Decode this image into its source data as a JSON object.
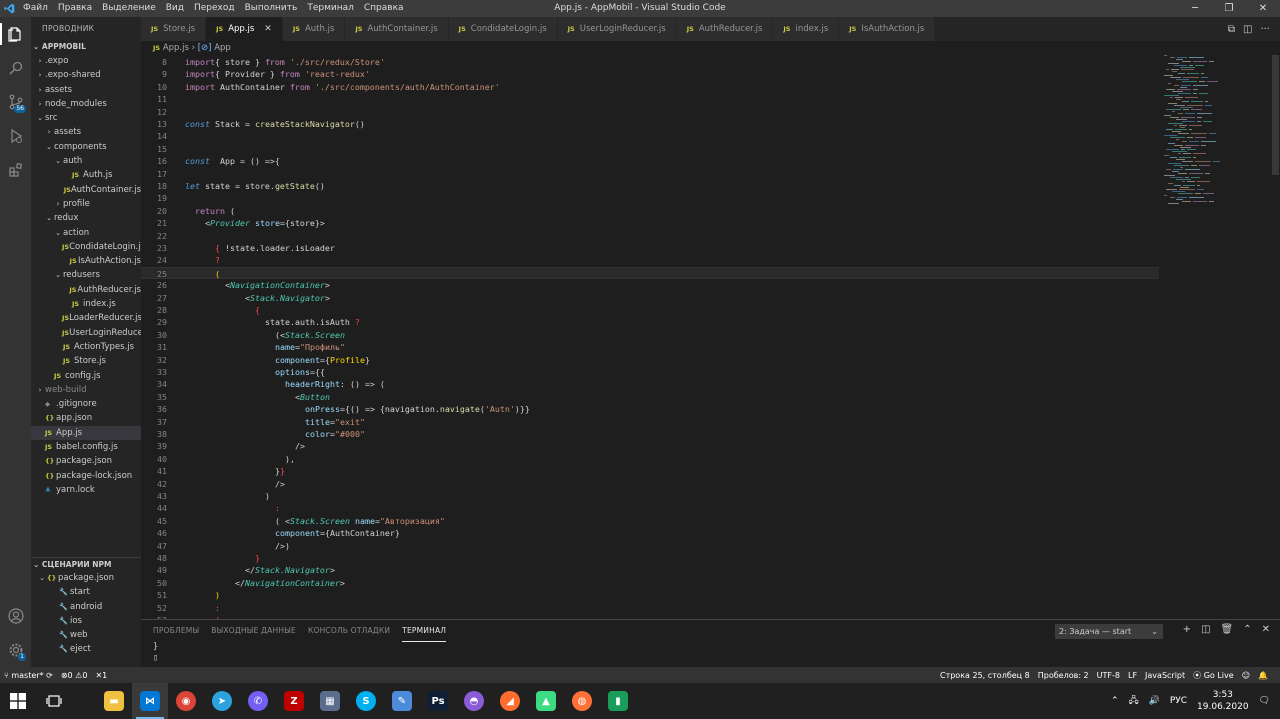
{
  "window": {
    "title": "App.js - AppMobil - Visual Studio Code",
    "menu": [
      "Файл",
      "Правка",
      "Выделение",
      "Вид",
      "Переход",
      "Выполнить",
      "Терминал",
      "Справка"
    ]
  },
  "sidebar": {
    "header": "ПРОВОДНИК",
    "project": "APPMOBIL",
    "items": [
      {
        "label": ".expo",
        "depth": 0,
        "kind": "folder",
        "open": false
      },
      {
        "label": ".expo-shared",
        "depth": 0,
        "kind": "folder",
        "open": false
      },
      {
        "label": "assets",
        "depth": 0,
        "kind": "folder",
        "open": false
      },
      {
        "label": "node_modules",
        "depth": 0,
        "kind": "folder",
        "open": false
      },
      {
        "label": "src",
        "depth": 0,
        "kind": "folder",
        "open": true
      },
      {
        "label": "assets",
        "depth": 1,
        "kind": "folder",
        "open": false
      },
      {
        "label": "components",
        "depth": 1,
        "kind": "folder",
        "open": true
      },
      {
        "label": "auth",
        "depth": 2,
        "kind": "folder",
        "open": true
      },
      {
        "label": "Auth.js",
        "depth": 3,
        "kind": "js"
      },
      {
        "label": "AuthContainer.js",
        "depth": 3,
        "kind": "js"
      },
      {
        "label": "profile",
        "depth": 2,
        "kind": "folder",
        "open": false
      },
      {
        "label": "redux",
        "depth": 1,
        "kind": "folder",
        "open": true
      },
      {
        "label": "action",
        "depth": 2,
        "kind": "folder",
        "open": true
      },
      {
        "label": "CondidateLogin.js",
        "depth": 3,
        "kind": "js"
      },
      {
        "label": "IsAuthAction.js",
        "depth": 3,
        "kind": "js"
      },
      {
        "label": "redusers",
        "depth": 2,
        "kind": "folder",
        "open": true
      },
      {
        "label": "AuthReducer.js",
        "depth": 3,
        "kind": "js"
      },
      {
        "label": "index.js",
        "depth": 3,
        "kind": "js"
      },
      {
        "label": "LoaderReducer.js",
        "depth": 3,
        "kind": "js"
      },
      {
        "label": "UserLoginReduce...",
        "depth": 3,
        "kind": "js"
      },
      {
        "label": "ActionTypes.js",
        "depth": 2,
        "kind": "js"
      },
      {
        "label": "Store.js",
        "depth": 2,
        "kind": "js"
      },
      {
        "label": "config.js",
        "depth": 1,
        "kind": "js"
      },
      {
        "label": "web-build",
        "depth": 0,
        "kind": "folder",
        "open": false,
        "dim": true
      },
      {
        "label": ".gitignore",
        "depth": 0,
        "kind": "dim"
      },
      {
        "label": "app.json",
        "depth": 0,
        "kind": "json"
      },
      {
        "label": "App.js",
        "depth": 0,
        "kind": "js",
        "selected": true
      },
      {
        "label": "babel.config.js",
        "depth": 0,
        "kind": "js"
      },
      {
        "label": "package.json",
        "depth": 0,
        "kind": "json"
      },
      {
        "label": "package-lock.json",
        "depth": 0,
        "kind": "json"
      },
      {
        "label": "yarn.lock",
        "depth": 0,
        "kind": "yarn"
      }
    ],
    "npm": {
      "header": "СЦЕНАРИИ NPM",
      "file": "package.json",
      "scripts": [
        "start",
        "android",
        "ios",
        "web",
        "eject"
      ]
    }
  },
  "tabs": [
    {
      "label": "Store.js",
      "active": false
    },
    {
      "label": "App.js",
      "active": true
    },
    {
      "label": "Auth.js",
      "active": false
    },
    {
      "label": "AuthContainer.js",
      "active": false
    },
    {
      "label": "CondidateLogin.js",
      "active": false
    },
    {
      "label": "UserLoginReducer.js",
      "active": false
    },
    {
      "label": "AuthReducer.js",
      "active": false
    },
    {
      "label": "index.js",
      "active": false
    },
    {
      "label": "IsAuthAction.js",
      "active": false
    }
  ],
  "breadcrumb": {
    "file": "App.js",
    "symbol": "App"
  },
  "editor": {
    "current_line": 25,
    "lines": [
      {
        "n": 8,
        "indent": 0,
        "tokens": [
          [
            "k",
            "import"
          ],
          [
            "",
            "{ store } "
          ],
          [
            "k",
            "from"
          ],
          [
            "s",
            " './src/redux/Store'"
          ]
        ]
      },
      {
        "n": 9,
        "indent": 0,
        "tokens": [
          [
            "k",
            "import"
          ],
          [
            "",
            "{ Provider } "
          ],
          [
            "k",
            "from"
          ],
          [
            "s",
            " 'react-redux'"
          ]
        ]
      },
      {
        "n": 10,
        "indent": 0,
        "tokens": [
          [
            "k",
            "import"
          ],
          [
            "",
            " AuthContainer "
          ],
          [
            "k",
            "from"
          ],
          [
            "s",
            " './src/components/auth/AuthContainer'"
          ]
        ]
      },
      {
        "n": 11,
        "indent": 0,
        "tokens": []
      },
      {
        "n": 12,
        "indent": 0,
        "tokens": []
      },
      {
        "n": 13,
        "indent": 0,
        "tokens": [
          [
            "kw",
            "const"
          ],
          [
            "",
            " Stack = "
          ],
          [
            "f",
            "createStackNavigator"
          ],
          [
            "",
            "()"
          ]
        ]
      },
      {
        "n": 14,
        "indent": 0,
        "tokens": []
      },
      {
        "n": 15,
        "indent": 0,
        "tokens": []
      },
      {
        "n": 16,
        "indent": 0,
        "tokens": [
          [
            "kw",
            "const"
          ],
          [
            "",
            "  App = () =>{"
          ]
        ]
      },
      {
        "n": 17,
        "indent": 0,
        "tokens": []
      },
      {
        "n": 18,
        "indent": 0,
        "tokens": [
          [
            "kw",
            "let"
          ],
          [
            "",
            " state = store."
          ],
          [
            "f",
            "getState"
          ],
          [
            "",
            "()"
          ]
        ]
      },
      {
        "n": 19,
        "indent": 0,
        "tokens": []
      },
      {
        "n": 20,
        "indent": 1,
        "tokens": [
          [
            "k",
            "return"
          ],
          [
            "",
            " ("
          ]
        ]
      },
      {
        "n": 21,
        "indent": 2,
        "tokens": [
          [
            "",
            "<"
          ],
          [
            "t",
            "Provider"
          ],
          [
            "",
            " "
          ],
          [
            "v",
            "store"
          ],
          [
            "",
            "={store}>"
          ]
        ]
      },
      {
        "n": 22,
        "indent": 0,
        "tokens": []
      },
      {
        "n": 23,
        "indent": 3,
        "tokens": [
          [
            "r",
            "{"
          ],
          [
            "",
            " !state.loader.isLoader"
          ]
        ]
      },
      {
        "n": 24,
        "indent": 3,
        "tokens": [
          [
            "r",
            "?"
          ]
        ]
      },
      {
        "n": 25,
        "indent": 3,
        "tokens": [
          [
            "y",
            "("
          ]
        ]
      },
      {
        "n": 26,
        "indent": 4,
        "tokens": [
          [
            "",
            "<"
          ],
          [
            "t",
            "NavigationContainer"
          ],
          [
            "",
            ">"
          ]
        ]
      },
      {
        "n": 27,
        "indent": 6,
        "tokens": [
          [
            "",
            "<"
          ],
          [
            "t",
            "Stack.Navigator"
          ],
          [
            "",
            ">"
          ]
        ]
      },
      {
        "n": 28,
        "indent": 7,
        "tokens": [
          [
            "r",
            "{"
          ]
        ]
      },
      {
        "n": 29,
        "indent": 8,
        "tokens": [
          [
            "",
            "state.auth.isAuth "
          ],
          [
            "r",
            "?"
          ]
        ]
      },
      {
        "n": 30,
        "indent": 9,
        "tokens": [
          [
            "",
            "(<"
          ],
          [
            "t",
            "Stack.Screen"
          ]
        ]
      },
      {
        "n": 31,
        "indent": 9,
        "tokens": [
          [
            "v",
            "name"
          ],
          [
            "",
            "="
          ],
          [
            "s",
            "\"Профиль\""
          ]
        ]
      },
      {
        "n": 32,
        "indent": 9,
        "tokens": [
          [
            "v",
            "component"
          ],
          [
            "",
            "={"
          ],
          [
            "y",
            "Profile"
          ],
          [
            "",
            "}"
          ]
        ]
      },
      {
        "n": 33,
        "indent": 9,
        "tokens": [
          [
            "v",
            "options"
          ],
          [
            "",
            "={{"
          ]
        ]
      },
      {
        "n": 34,
        "indent": 10,
        "tokens": [
          [
            "v",
            "headerRight"
          ],
          [
            "",
            ": () => ("
          ]
        ]
      },
      {
        "n": 35,
        "indent": 11,
        "tokens": [
          [
            "",
            "<"
          ],
          [
            "t",
            "Button"
          ]
        ]
      },
      {
        "n": 36,
        "indent": 12,
        "tokens": [
          [
            "v",
            "onPress"
          ],
          [
            "",
            "={() => {navigation."
          ],
          [
            "f",
            "navigate"
          ],
          [
            "",
            "("
          ],
          [
            "s",
            "'Autn'"
          ],
          [
            "",
            ")}}"
          ]
        ]
      },
      {
        "n": 37,
        "indent": 12,
        "tokens": [
          [
            "v",
            "title"
          ],
          [
            "",
            "="
          ],
          [
            "s",
            "\"exit\""
          ]
        ]
      },
      {
        "n": 38,
        "indent": 12,
        "tokens": [
          [
            "v",
            "color"
          ],
          [
            "",
            "="
          ],
          [
            "s",
            "\"#000\""
          ]
        ]
      },
      {
        "n": 39,
        "indent": 11,
        "tokens": [
          [
            "",
            "/>"
          ]
        ]
      },
      {
        "n": 40,
        "indent": 10,
        "tokens": [
          [
            "",
            "),"
          ]
        ]
      },
      {
        "n": 41,
        "indent": 9,
        "tokens": [
          [
            "",
            "}"
          ],
          [
            "r",
            "}"
          ]
        ]
      },
      {
        "n": 42,
        "indent": 9,
        "tokens": [
          [
            "",
            "/>"
          ]
        ]
      },
      {
        "n": 43,
        "indent": 8,
        "tokens": [
          [
            "",
            ")"
          ]
        ]
      },
      {
        "n": 44,
        "indent": 9,
        "tokens": [
          [
            "r",
            ":"
          ]
        ]
      },
      {
        "n": 45,
        "indent": 9,
        "tokens": [
          [
            "",
            "( <"
          ],
          [
            "t",
            "Stack.Screen"
          ],
          [
            "",
            " "
          ],
          [
            "v",
            "name"
          ],
          [
            "",
            "="
          ],
          [
            "s",
            "\"Авторизация\""
          ]
        ]
      },
      {
        "n": 46,
        "indent": 9,
        "tokens": [
          [
            "v",
            "component"
          ],
          [
            "",
            "={AuthContainer}"
          ]
        ]
      },
      {
        "n": 47,
        "indent": 9,
        "tokens": [
          [
            "",
            "/>)"
          ]
        ]
      },
      {
        "n": 48,
        "indent": 7,
        "tokens": [
          [
            "r",
            "}"
          ]
        ]
      },
      {
        "n": 49,
        "indent": 6,
        "tokens": [
          [
            "",
            "</"
          ],
          [
            "t",
            "Stack.Navigator"
          ],
          [
            "",
            ">"
          ]
        ]
      },
      {
        "n": 50,
        "indent": 5,
        "tokens": [
          [
            "",
            "</"
          ],
          [
            "t",
            "NavigationContainer"
          ],
          [
            "",
            ">"
          ]
        ]
      },
      {
        "n": 51,
        "indent": 3,
        "tokens": [
          [
            "y",
            ")"
          ]
        ]
      },
      {
        "n": 52,
        "indent": 3,
        "tokens": [
          [
            "r",
            ":"
          ]
        ]
      },
      {
        "n": 53,
        "indent": 3,
        "tokens": [
          [
            "r",
            "("
          ]
        ]
      }
    ]
  },
  "panel": {
    "tabs": [
      "ПРОБЛЕМЫ",
      "ВЫХОДНЫЕ ДАННЫЕ",
      "КОНСОЛЬ ОТЛАДКИ",
      "ТЕРМИНАЛ"
    ],
    "active_tab": "ТЕРМИНАЛ",
    "terminal_select": "2: Задача — start",
    "terminal_lines": [
      "}",
      "▯"
    ]
  },
  "statusbar": {
    "branch": "master*",
    "errors": "0",
    "warnings": "0",
    "ports": "1",
    "position": "Строка 25, столбец 8",
    "spaces": "Пробелов: 2",
    "encoding": "UTF-8",
    "eol": "LF",
    "language": "JavaScript",
    "golive": "Go Live"
  },
  "taskbar": {
    "apps": [
      {
        "name": "file-explorer",
        "color": "#f0c040"
      },
      {
        "name": "vscode",
        "color": "#0078d4",
        "active": true
      },
      {
        "name": "chrome",
        "color": "#db4437"
      },
      {
        "name": "telegram",
        "color": "#2aa3df"
      },
      {
        "name": "viber",
        "color": "#7360f2"
      },
      {
        "name": "filezilla",
        "color": "#bf0000"
      },
      {
        "name": "calculator",
        "color": "#5a6d8c"
      },
      {
        "name": "skype",
        "color": "#00aff0"
      },
      {
        "name": "paint",
        "color": "#4c8bd9"
      },
      {
        "name": "photoshop",
        "color": "#0e1e35"
      },
      {
        "name": "app-purple",
        "color": "#8a5cd8"
      },
      {
        "name": "app-orange",
        "color": "#ff6d2c"
      },
      {
        "name": "android-studio",
        "color": "#3ddc84"
      },
      {
        "name": "firefox",
        "color": "#ff7139"
      },
      {
        "name": "app-green",
        "color": "#1a9c5a"
      }
    ],
    "lang": "РУС",
    "time": "3:53",
    "date": "19.06.2020"
  },
  "colors": {
    "accent": "#007acc",
    "editor_bg": "#1e1e1e",
    "sidebar_bg": "#252526",
    "statusbar_bg": "#333333"
  }
}
